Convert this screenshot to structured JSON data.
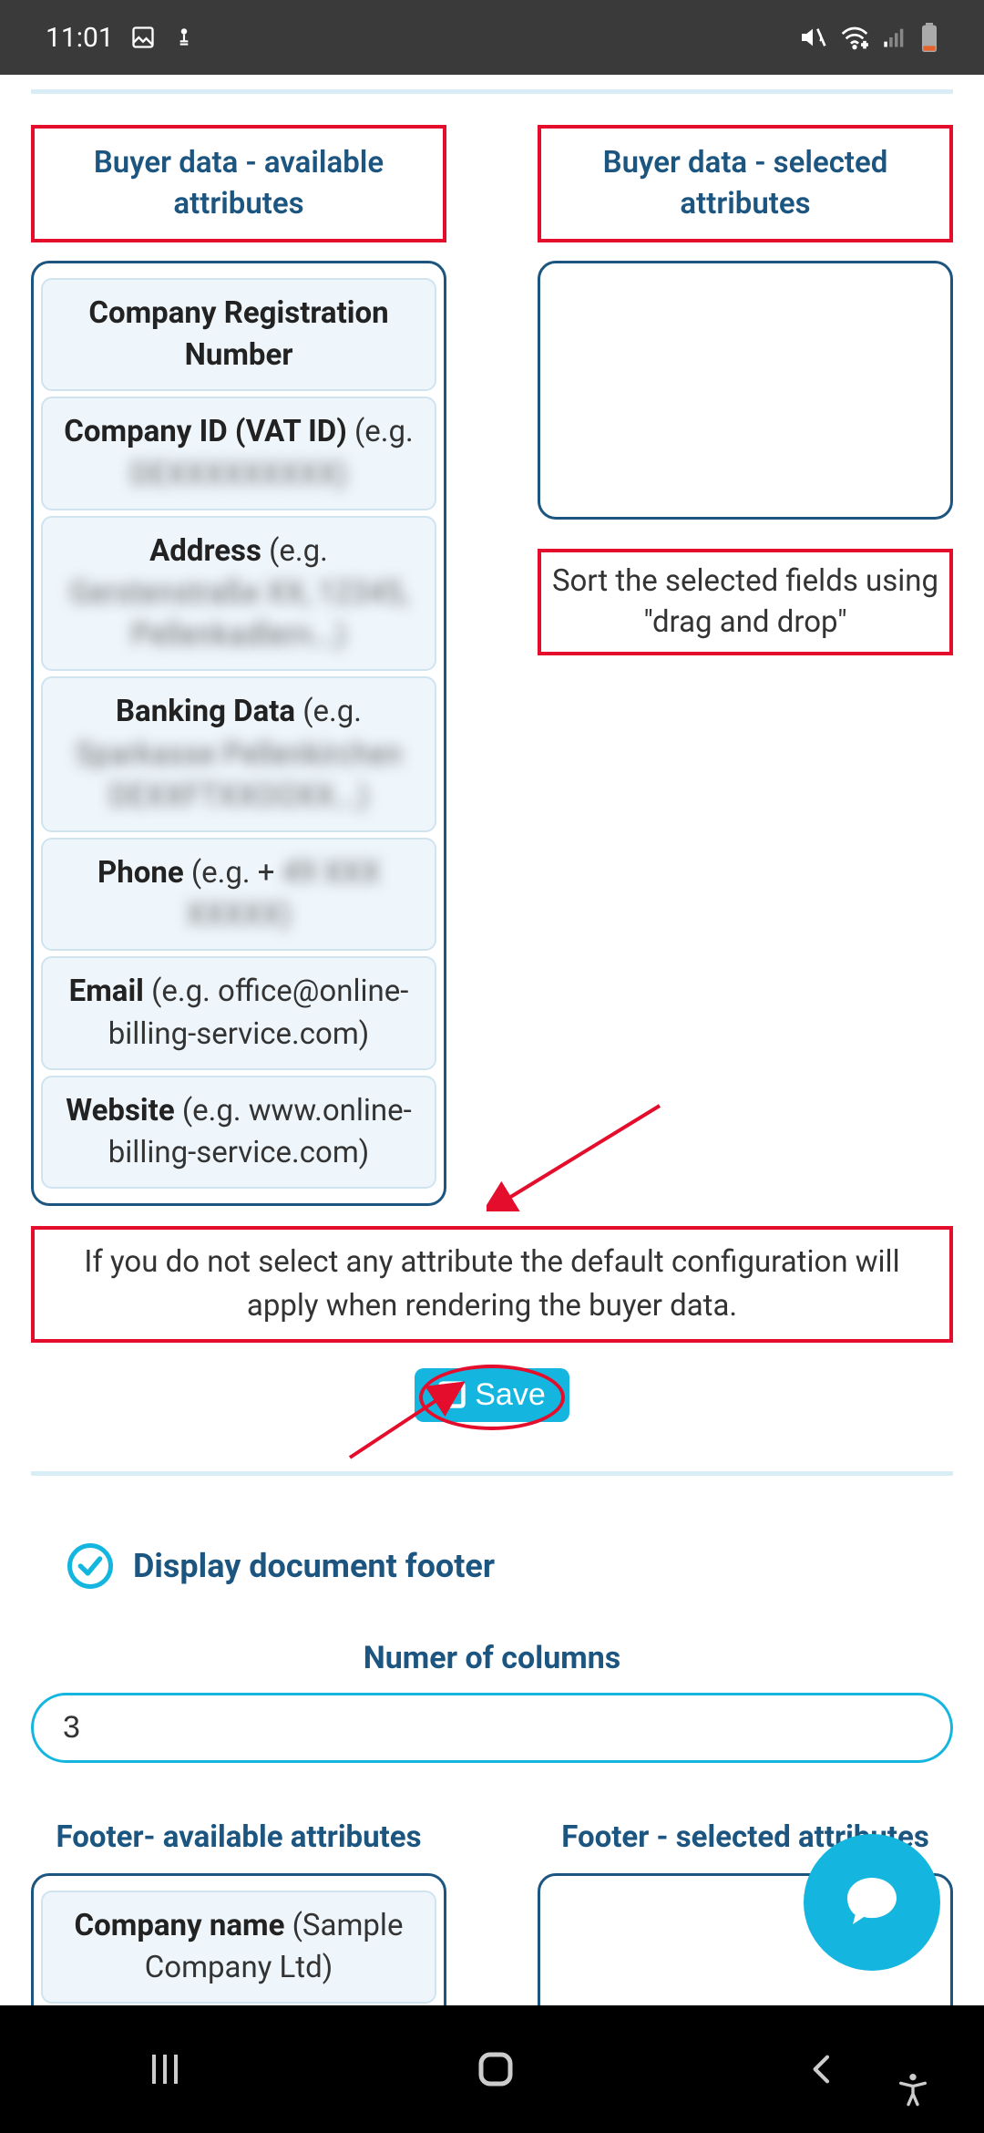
{
  "status": {
    "time": "11:01"
  },
  "buyer_available": {
    "header": "Buyer data - available attributes",
    "items": [
      {
        "name": "Company Registration Number",
        "eg": "",
        "blur": ""
      },
      {
        "name": "Company ID (VAT ID)",
        "eg": "(e.g.",
        "blur": "DEXXXXXXXXX)"
      },
      {
        "name": "Address",
        "eg": "(e.g.",
        "blur": "Gerstenstraße XX, 12345, Pellenkadlern...)"
      },
      {
        "name": "Banking Data",
        "eg": "(e.g.",
        "blur": "Sparkasse Pellenkirchen DEXXFTXXOOXX...)"
      },
      {
        "name": "Phone",
        "eg": "(e.g. +",
        "blur": "49 XXX XXXXX)"
      },
      {
        "name": "Email",
        "eg": "(e.g. office@online-billing-service.com)",
        "blur": ""
      },
      {
        "name": "Website",
        "eg": "(e.g. www.online-billing-service.com)",
        "blur": ""
      }
    ]
  },
  "buyer_selected": {
    "header": "Buyer data - selected attributes",
    "sort_hint": "Sort the selected fields using \"drag and drop\""
  },
  "info": "If you do not select any attribute the default configuration will apply when rendering the buyer data.",
  "save_label": "Save",
  "footer_toggle_label": "Display document footer",
  "num_columns": {
    "label": "Numer of columns",
    "value": "3"
  },
  "footer_available": {
    "header": "Footer- available attributes",
    "items": [
      {
        "name": "Company name",
        "eg": "(Sample Company Ltd)"
      }
    ]
  },
  "footer_selected": {
    "header": "Footer - selected attributes"
  }
}
